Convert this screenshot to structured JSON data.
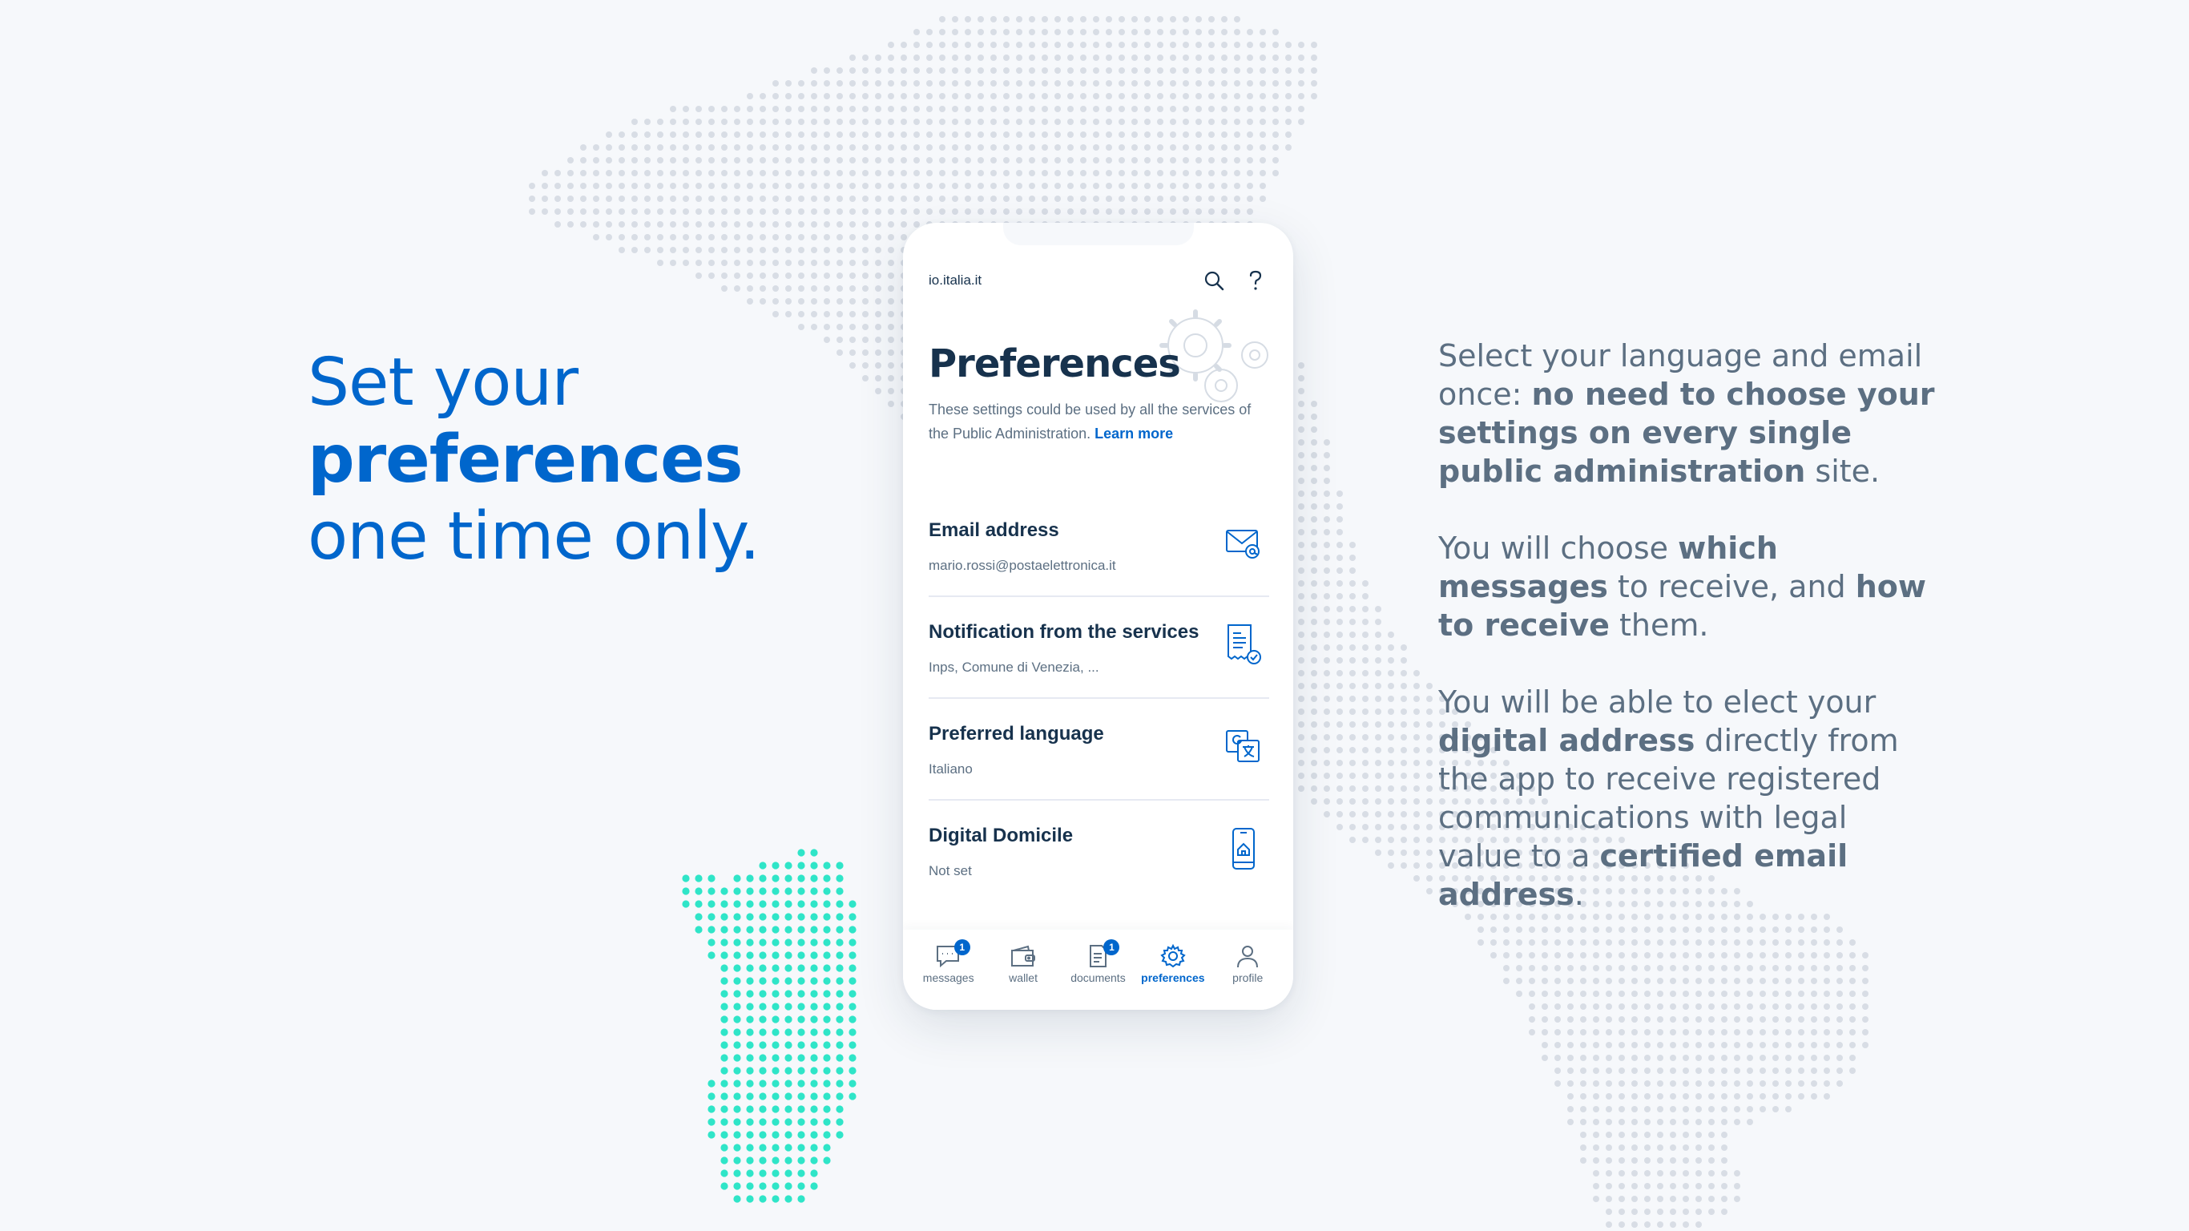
{
  "colors": {
    "brand_blue": "#0066cc",
    "text_dark": "#17324d",
    "text_muted": "#5c6f82",
    "map_dot": "#d8dde5",
    "region_highlight": "#2fe5c8",
    "background": "#f6f8fb"
  },
  "headline": {
    "line1": "Set your",
    "line2": "preferences",
    "line3": "one time only."
  },
  "description": {
    "p1_a": "Select your language and email once: ",
    "p1_b": "no need to choose your settings on every single public administration",
    "p1_c": " site.",
    "p2_a": "You will choose ",
    "p2_b": "which messages",
    "p2_c": " to receive, and ",
    "p2_d": "how to receive",
    "p2_e": " them.",
    "p3_a": "You will be able to elect your ",
    "p3_b": "digital address",
    "p3_c": " directly from the app to receive registered communications with legal value to a ",
    "p3_d": "certified email address",
    "p3_e": "."
  },
  "phone": {
    "app_url": "io.italia.it",
    "icons": {
      "search": "search-icon",
      "help": "help-icon",
      "illustration": "gears-icon"
    },
    "title": "Preferences",
    "subtitle": "These settings could be used by all the services of the Public Administration.",
    "learn_more": "Learn more",
    "items": [
      {
        "label": "Email address",
        "value": "mario.rossi@postaelettronica.it",
        "icon": "email-icon"
      },
      {
        "label": "Notification from the services",
        "value": "Inps, Comune di Venezia, ...",
        "icon": "document-check-icon"
      },
      {
        "label": "Preferred language",
        "value": "Italiano",
        "icon": "translate-icon"
      },
      {
        "label": "Digital Domicile",
        "value": "Not set",
        "icon": "smartphone-home-icon"
      }
    ],
    "tabs": [
      {
        "label": "messages",
        "badge": "1",
        "icon": "messages-icon",
        "active": false
      },
      {
        "label": "wallet",
        "badge": "",
        "icon": "wallet-icon",
        "active": false
      },
      {
        "label": "documents",
        "badge": "1",
        "icon": "documents-icon",
        "active": false
      },
      {
        "label": "preferences",
        "badge": "",
        "icon": "gear-icon",
        "active": true
      },
      {
        "label": "profile",
        "badge": "",
        "icon": "profile-icon",
        "active": false
      }
    ]
  }
}
